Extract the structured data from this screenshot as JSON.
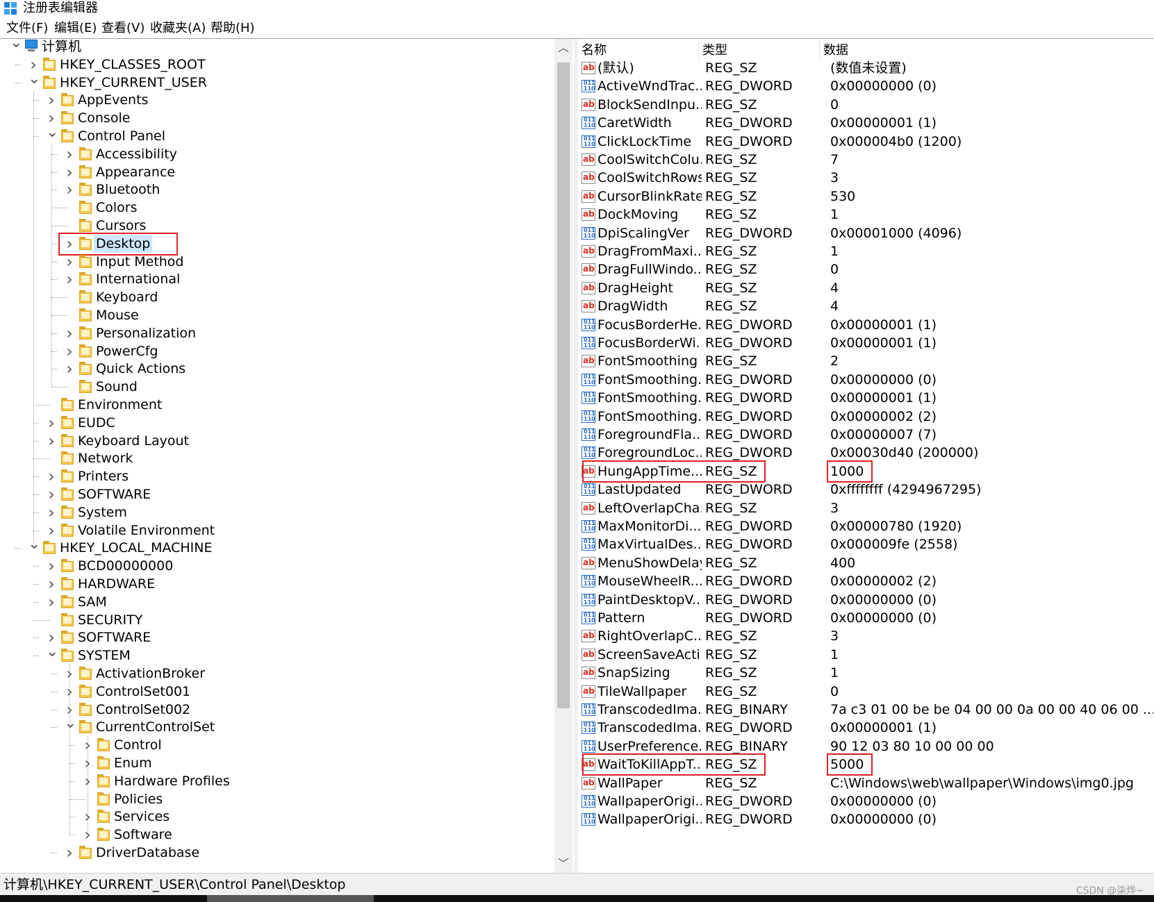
{
  "window": {
    "title": "注册表编辑器"
  },
  "menu": [
    "文件(F)",
    "编辑(E)",
    "查看(V)",
    "收藏夹(A)",
    "帮助(H)"
  ],
  "tree": [
    {
      "label": "计算机",
      "level": 0,
      "exp": "open",
      "icon": "computer-icon"
    },
    {
      "label": "HKEY_CLASSES_ROOT",
      "level": 1,
      "exp": "closed"
    },
    {
      "label": "HKEY_CURRENT_USER",
      "level": 1,
      "exp": "open"
    },
    {
      "label": "AppEvents",
      "level": 2,
      "exp": "closed"
    },
    {
      "label": "Console",
      "level": 2,
      "exp": "closed"
    },
    {
      "label": "Control Panel",
      "level": 2,
      "exp": "open"
    },
    {
      "label": "Accessibility",
      "level": 3,
      "exp": "closed"
    },
    {
      "label": "Appearance",
      "level": 3,
      "exp": "closed"
    },
    {
      "label": "Bluetooth",
      "level": 3,
      "exp": "closed"
    },
    {
      "label": "Colors",
      "level": 3,
      "exp": "none"
    },
    {
      "label": "Cursors",
      "level": 3,
      "exp": "none"
    },
    {
      "label": "Desktop",
      "level": 3,
      "exp": "closed",
      "selected": true,
      "highlighted": true
    },
    {
      "label": "Input Method",
      "level": 3,
      "exp": "closed"
    },
    {
      "label": "International",
      "level": 3,
      "exp": "closed"
    },
    {
      "label": "Keyboard",
      "level": 3,
      "exp": "none"
    },
    {
      "label": "Mouse",
      "level": 3,
      "exp": "none"
    },
    {
      "label": "Personalization",
      "level": 3,
      "exp": "closed"
    },
    {
      "label": "PowerCfg",
      "level": 3,
      "exp": "closed"
    },
    {
      "label": "Quick Actions",
      "level": 3,
      "exp": "closed"
    },
    {
      "label": "Sound",
      "level": 3,
      "exp": "none"
    },
    {
      "label": "Environment",
      "level": 2,
      "exp": "none"
    },
    {
      "label": "EUDC",
      "level": 2,
      "exp": "closed"
    },
    {
      "label": "Keyboard Layout",
      "level": 2,
      "exp": "closed"
    },
    {
      "label": "Network",
      "level": 2,
      "exp": "none"
    },
    {
      "label": "Printers",
      "level": 2,
      "exp": "closed"
    },
    {
      "label": "SOFTWARE",
      "level": 2,
      "exp": "closed"
    },
    {
      "label": "System",
      "level": 2,
      "exp": "closed"
    },
    {
      "label": "Volatile Environment",
      "level": 2,
      "exp": "closed"
    },
    {
      "label": "HKEY_LOCAL_MACHINE",
      "level": 1,
      "exp": "open"
    },
    {
      "label": "BCD00000000",
      "level": 2,
      "exp": "closed"
    },
    {
      "label": "HARDWARE",
      "level": 2,
      "exp": "closed"
    },
    {
      "label": "SAM",
      "level": 2,
      "exp": "closed"
    },
    {
      "label": "SECURITY",
      "level": 2,
      "exp": "none"
    },
    {
      "label": "SOFTWARE",
      "level": 2,
      "exp": "closed"
    },
    {
      "label": "SYSTEM",
      "level": 2,
      "exp": "open"
    },
    {
      "label": "ActivationBroker",
      "level": 3,
      "exp": "closed"
    },
    {
      "label": "ControlSet001",
      "level": 3,
      "exp": "closed"
    },
    {
      "label": "ControlSet002",
      "level": 3,
      "exp": "closed"
    },
    {
      "label": "CurrentControlSet",
      "level": 3,
      "exp": "open"
    },
    {
      "label": "Control",
      "level": 4,
      "exp": "closed"
    },
    {
      "label": "Enum",
      "level": 4,
      "exp": "closed"
    },
    {
      "label": "Hardware Profiles",
      "level": 4,
      "exp": "closed"
    },
    {
      "label": "Policies",
      "level": 4,
      "exp": "none"
    },
    {
      "label": "Services",
      "level": 4,
      "exp": "closed"
    },
    {
      "label": "Software",
      "level": 4,
      "exp": "closed"
    },
    {
      "label": "DriverDatabase",
      "level": 3,
      "exp": "closed"
    }
  ],
  "list": {
    "columns": [
      "名称",
      "类型",
      "数据"
    ],
    "rows": [
      {
        "name": "(默认)",
        "type": "REG_SZ",
        "data": "(数值未设置)",
        "icon": "ab"
      },
      {
        "name": "ActiveWndTrac...",
        "type": "REG_DWORD",
        "data": "0x00000000 (0)",
        "icon": "bin"
      },
      {
        "name": "BlockSendInpu...",
        "type": "REG_SZ",
        "data": "0",
        "icon": "ab"
      },
      {
        "name": "CaretWidth",
        "type": "REG_DWORD",
        "data": "0x00000001 (1)",
        "icon": "bin"
      },
      {
        "name": "ClickLockTime",
        "type": "REG_DWORD",
        "data": "0x000004b0 (1200)",
        "icon": "bin"
      },
      {
        "name": "CoolSwitchColu...",
        "type": "REG_SZ",
        "data": "7",
        "icon": "ab"
      },
      {
        "name": "CoolSwitchRows",
        "type": "REG_SZ",
        "data": "3",
        "icon": "ab"
      },
      {
        "name": "CursorBlinkRate",
        "type": "REG_SZ",
        "data": "530",
        "icon": "ab"
      },
      {
        "name": "DockMoving",
        "type": "REG_SZ",
        "data": "1",
        "icon": "ab"
      },
      {
        "name": "DpiScalingVer",
        "type": "REG_DWORD",
        "data": "0x00001000 (4096)",
        "icon": "bin"
      },
      {
        "name": "DragFromMaxi...",
        "type": "REG_SZ",
        "data": "1",
        "icon": "ab"
      },
      {
        "name": "DragFullWindo...",
        "type": "REG_SZ",
        "data": "0",
        "icon": "ab"
      },
      {
        "name": "DragHeight",
        "type": "REG_SZ",
        "data": "4",
        "icon": "ab"
      },
      {
        "name": "DragWidth",
        "type": "REG_SZ",
        "data": "4",
        "icon": "ab"
      },
      {
        "name": "FocusBorderHe...",
        "type": "REG_DWORD",
        "data": "0x00000001 (1)",
        "icon": "bin"
      },
      {
        "name": "FocusBorderWi...",
        "type": "REG_DWORD",
        "data": "0x00000001 (1)",
        "icon": "bin"
      },
      {
        "name": "FontSmoothing",
        "type": "REG_SZ",
        "data": "2",
        "icon": "ab"
      },
      {
        "name": "FontSmoothing...",
        "type": "REG_DWORD",
        "data": "0x00000000 (0)",
        "icon": "bin"
      },
      {
        "name": "FontSmoothing...",
        "type": "REG_DWORD",
        "data": "0x00000001 (1)",
        "icon": "bin"
      },
      {
        "name": "FontSmoothing...",
        "type": "REG_DWORD",
        "data": "0x00000002 (2)",
        "icon": "bin"
      },
      {
        "name": "ForegroundFla...",
        "type": "REG_DWORD",
        "data": "0x00000007 (7)",
        "icon": "bin"
      },
      {
        "name": "ForegroundLoc...",
        "type": "REG_DWORD",
        "data": "0x00030d40 (200000)",
        "icon": "bin"
      },
      {
        "name": "HungAppTime...",
        "type": "REG_SZ",
        "data": "1000",
        "icon": "ab",
        "highlighted": true
      },
      {
        "name": "LastUpdated",
        "type": "REG_DWORD",
        "data": "0xffffffff (4294967295)",
        "icon": "bin"
      },
      {
        "name": "LeftOverlapCha...",
        "type": "REG_SZ",
        "data": "3",
        "icon": "ab"
      },
      {
        "name": "MaxMonitorDi...",
        "type": "REG_DWORD",
        "data": "0x00000780 (1920)",
        "icon": "bin"
      },
      {
        "name": "MaxVirtualDes...",
        "type": "REG_DWORD",
        "data": "0x000009fe (2558)",
        "icon": "bin"
      },
      {
        "name": "MenuShowDelay",
        "type": "REG_SZ",
        "data": "400",
        "icon": "ab"
      },
      {
        "name": "MouseWheelR...",
        "type": "REG_DWORD",
        "data": "0x00000002 (2)",
        "icon": "bin"
      },
      {
        "name": "PaintDesktopV...",
        "type": "REG_DWORD",
        "data": "0x00000000 (0)",
        "icon": "bin"
      },
      {
        "name": "Pattern",
        "type": "REG_DWORD",
        "data": "0x00000000 (0)",
        "icon": "bin"
      },
      {
        "name": "RightOverlapC...",
        "type": "REG_SZ",
        "data": "3",
        "icon": "ab"
      },
      {
        "name": "ScreenSaveActi...",
        "type": "REG_SZ",
        "data": "1",
        "icon": "ab"
      },
      {
        "name": "SnapSizing",
        "type": "REG_SZ",
        "data": "1",
        "icon": "ab"
      },
      {
        "name": "TileWallpaper",
        "type": "REG_SZ",
        "data": "0",
        "icon": "ab"
      },
      {
        "name": "TranscodedIma...",
        "type": "REG_BINARY",
        "data": "7a c3 01 00 be be 04 00 00 0a 00 00 40 06 00 ...",
        "icon": "bin"
      },
      {
        "name": "TranscodedIma...",
        "type": "REG_DWORD",
        "data": "0x00000001 (1)",
        "icon": "bin"
      },
      {
        "name": "UserPreference...",
        "type": "REG_BINARY",
        "data": "90 12 03 80 10 00 00 00",
        "icon": "bin"
      },
      {
        "name": "WaitToKillAppT...",
        "type": "REG_SZ",
        "data": "5000",
        "icon": "ab",
        "highlighted": true
      },
      {
        "name": "WallPaper",
        "type": "REG_SZ",
        "data": "C:\\Windows\\web\\wallpaper\\Windows\\img0.jpg",
        "icon": "ab"
      },
      {
        "name": "WallpaperOrigi...",
        "type": "REG_DWORD",
        "data": "0x00000000 (0)",
        "icon": "bin"
      },
      {
        "name": "WallpaperOrigi...",
        "type": "REG_DWORD",
        "data": "0x00000000 (0)",
        "icon": "bin"
      }
    ]
  },
  "status": {
    "path": "计算机\\HKEY_CURRENT_USER\\Control Panel\\Desktop"
  },
  "watermark": "CSDN @柒烨~",
  "colors": {
    "highlight_box": "#e02020",
    "selection": "#cce8ff",
    "folder": "#f3c64b"
  }
}
